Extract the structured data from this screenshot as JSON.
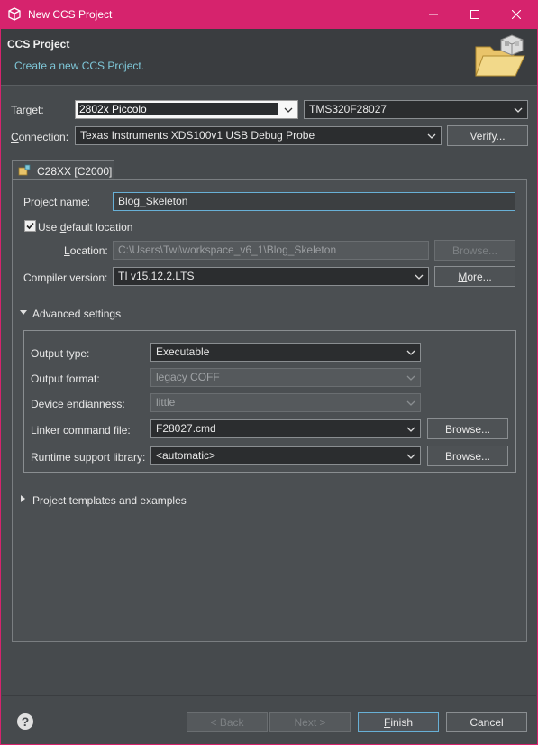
{
  "window": {
    "title": "New CCS Project",
    "icons": {
      "app": "cube-icon",
      "minimize": "minimize-icon",
      "maximize": "maximize-icon",
      "close": "close-icon"
    },
    "accent": "#d6236d"
  },
  "header": {
    "title": "CCS Project",
    "description": "Create a new CCS Project.",
    "icon": "folder-icon"
  },
  "target": {
    "label": "Target:",
    "family": "2802x Piccolo",
    "device": "TMS320F28027"
  },
  "connection": {
    "label": "Connection:",
    "value": "Texas Instruments XDS100v1 USB Debug Probe",
    "verify_label": "Verify..."
  },
  "tab": {
    "label": "C28XX [C2000]"
  },
  "project": {
    "name_label": "Project name:",
    "name_value": "Blog_Skeleton",
    "use_default_label": "Use default location",
    "use_default_checked": true,
    "location_label": "Location:",
    "location_value": "C:\\Users\\Twi\\workspace_v6_1\\Blog_Skeleton",
    "browse_label": "Browse...",
    "compiler_label": "Compiler version:",
    "compiler_value": "TI v15.12.2.LTS",
    "more_label": "More..."
  },
  "advanced": {
    "section_label": "Advanced settings",
    "expanded": true,
    "output_type_label": "Output type:",
    "output_type_value": "Executable",
    "output_format_label": "Output format:",
    "output_format_value": "legacy COFF",
    "endianness_label": "Device endianness:",
    "endianness_value": "little",
    "linker_label": "Linker command file:",
    "linker_value": "F28027.cmd",
    "linker_browse": "Browse...",
    "rts_label": "Runtime support library:",
    "rts_value": "<automatic>",
    "rts_browse": "Browse..."
  },
  "templates": {
    "section_label": "Project templates and examples",
    "expanded": false
  },
  "footer": {
    "help_icon": "help-icon",
    "back_label": "< Back",
    "next_label": "Next >",
    "finish_label": "Finish",
    "cancel_label": "Cancel"
  }
}
